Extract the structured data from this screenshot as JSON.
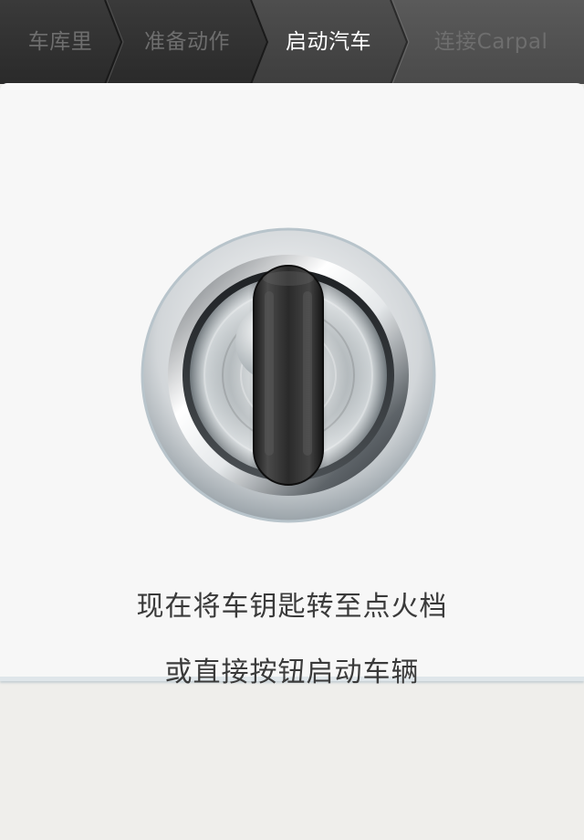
{
  "steps": [
    {
      "label": "车库里",
      "active": false
    },
    {
      "label": "准备动作",
      "active": false
    },
    {
      "label": "启动汽车",
      "active": true
    },
    {
      "label": "连接Carpal",
      "active": false
    }
  ],
  "ignition": {
    "icon": "ignition-key-icon"
  },
  "instructions": {
    "line1": "现在将车钥匙转至点火档",
    "line2": "或直接按钮启动车辆"
  }
}
